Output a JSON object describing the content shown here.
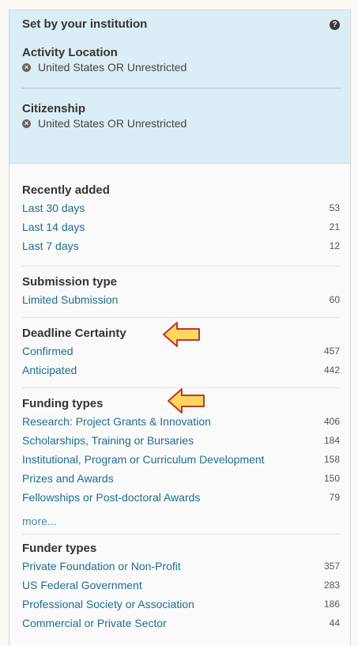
{
  "institution": {
    "title": "Set by your institution",
    "help_icon": "question-circle-icon",
    "sections": [
      {
        "title": "Activity Location",
        "item": "United States OR Unrestricted"
      },
      {
        "title": "Citizenship",
        "item": "United States OR Unrestricted"
      }
    ]
  },
  "facets": {
    "recently_added": {
      "title": "Recently added",
      "items": [
        {
          "label": "Last 30 days",
          "count": "53"
        },
        {
          "label": "Last 14 days",
          "count": "21"
        },
        {
          "label": "Last 7 days",
          "count": "12"
        }
      ]
    },
    "submission_type": {
      "title": "Submission type",
      "items": [
        {
          "label": "Limited Submission",
          "count": "60"
        }
      ]
    },
    "deadline_certainty": {
      "title": "Deadline Certainty",
      "items": [
        {
          "label": "Confirmed",
          "count": "457"
        },
        {
          "label": "Anticipated",
          "count": "442"
        }
      ]
    },
    "funding_types": {
      "title": "Funding types",
      "items": [
        {
          "label": "Research: Project Grants & Innovation",
          "count": "406"
        },
        {
          "label": "Scholarships, Training or Bursaries",
          "count": "184"
        },
        {
          "label": "Institutional, Program or Curriculum Development",
          "count": "158"
        },
        {
          "label": "Prizes and Awards",
          "count": "150"
        },
        {
          "label": "Fellowships or Post-doctoral Awards",
          "count": "79"
        }
      ],
      "more": "more..."
    },
    "funder_types": {
      "title": "Funder types",
      "items": [
        {
          "label": "Private Foundation or Non-Profit",
          "count": "357"
        },
        {
          "label": "US Federal Government",
          "count": "283"
        },
        {
          "label": "Professional Society or Association",
          "count": "186"
        },
        {
          "label": "Commercial or Private Sector",
          "count": "44"
        }
      ]
    }
  },
  "colors": {
    "link": "#1f6e8c",
    "institution_bg": "#dbeef5",
    "arrow_fill": "#ffd75e",
    "arrow_stroke": "#c0352b"
  }
}
